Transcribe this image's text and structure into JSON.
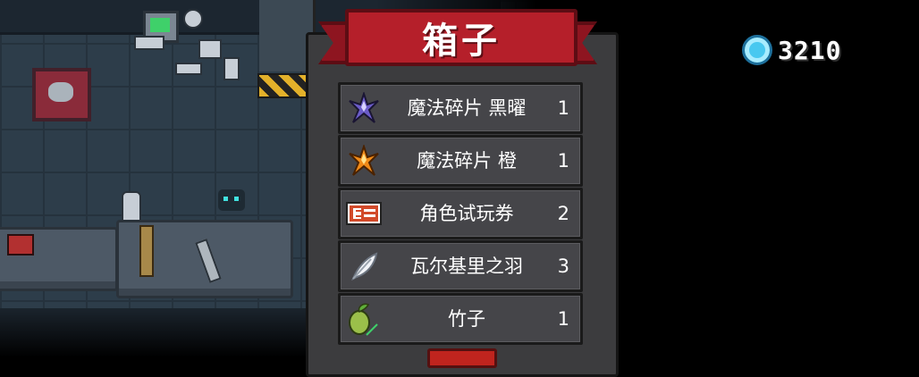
{
  "currency": {
    "icon": "blue-gem-icon",
    "amount": "3210"
  },
  "chest_dialog": {
    "title": "箱子",
    "items": [
      {
        "name": "魔法碎片 黑曜",
        "count": "1",
        "icon": "obsidian-shard-icon"
      },
      {
        "name": "魔法碎片 橙",
        "count": "1",
        "icon": "orange-shard-icon"
      },
      {
        "name": "角色试玩券",
        "count": "2",
        "icon": "character-trial-ticket-icon"
      },
      {
        "name": "瓦尔基里之羽",
        "count": "3",
        "icon": "valkyrie-feather-icon"
      },
      {
        "name": "竹子",
        "count": "1",
        "icon": "bamboo-sprout-icon"
      }
    ]
  },
  "colors": {
    "banner_red": "#b51f2a",
    "panel_bg": "#3c3c3e",
    "row_bg": "#454549",
    "gem_blue": "#48c8f0"
  }
}
